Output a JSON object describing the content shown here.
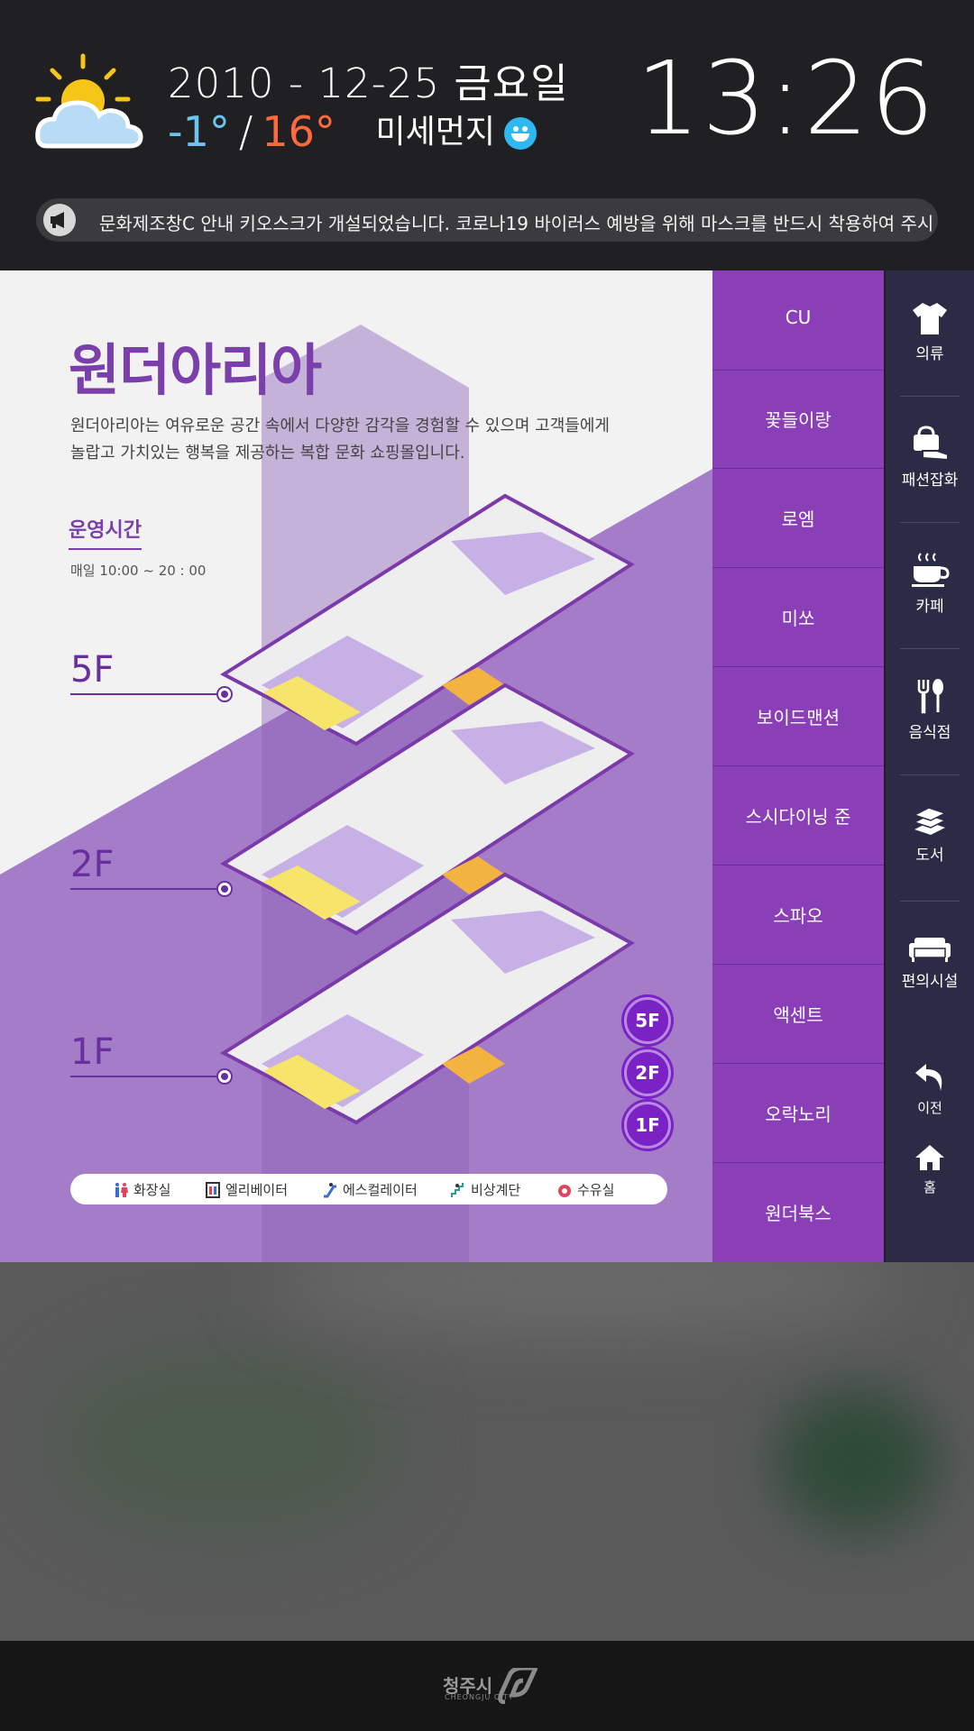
{
  "header": {
    "date": "2010 - 12-25 금요일",
    "temp_low": "-1°",
    "temp_separator": "/",
    "temp_high": "16°",
    "dust_label": "미세먼지",
    "clock": "13:26",
    "notice": "문화제조창C 안내 키오스크가 개설되었습니다. 코로나19 바이러스 예방을 위해 마스크를 반드시 착용하여 주시"
  },
  "mall": {
    "title": "원더아리아",
    "description": "원더아리아는 여유로운 공간 속에서 다양한 감각을 경험할 수  있으며 고객들에게 놀랍고 가치있는 행복을 제공하는 복합 문화 쇼핑몰입니다.",
    "hours_title": "운영시간",
    "hours": "매일 10:00 ~ 20 : 00"
  },
  "floors": {
    "labels": [
      "5F",
      "2F",
      "1F"
    ],
    "buttons": [
      "5F",
      "2F",
      "1F"
    ]
  },
  "legend": [
    "화장실",
    "엘리베이터",
    "에스컬레이터",
    "비상계단",
    "수유실"
  ],
  "stores": [
    "CU",
    "꽃들이랑",
    "로엠",
    "미쏘",
    "보이드맨션",
    "스시다이닝 준",
    "스파오",
    "액센트",
    "오락노리",
    "원더북스"
  ],
  "categories": [
    {
      "label": "의류",
      "icon": "shirt-icon"
    },
    {
      "label": "패션잡화",
      "icon": "bag-shoe-icon"
    },
    {
      "label": "카페",
      "icon": "coffee-icon"
    },
    {
      "label": "음식점",
      "icon": "cutlery-icon"
    },
    {
      "label": "도서",
      "icon": "books-icon"
    },
    {
      "label": "편의시설",
      "icon": "sofa-icon"
    }
  ],
  "nav": {
    "back": "이전",
    "home": "홈"
  },
  "footer": {
    "city": "청주시",
    "city_en": "CHEONGJU CITY"
  },
  "colors": {
    "accent": "#8a3fb6",
    "side_bar": "#2c2b45",
    "temp_low": "#6cc4f0",
    "temp_high": "#ff6a3d"
  }
}
